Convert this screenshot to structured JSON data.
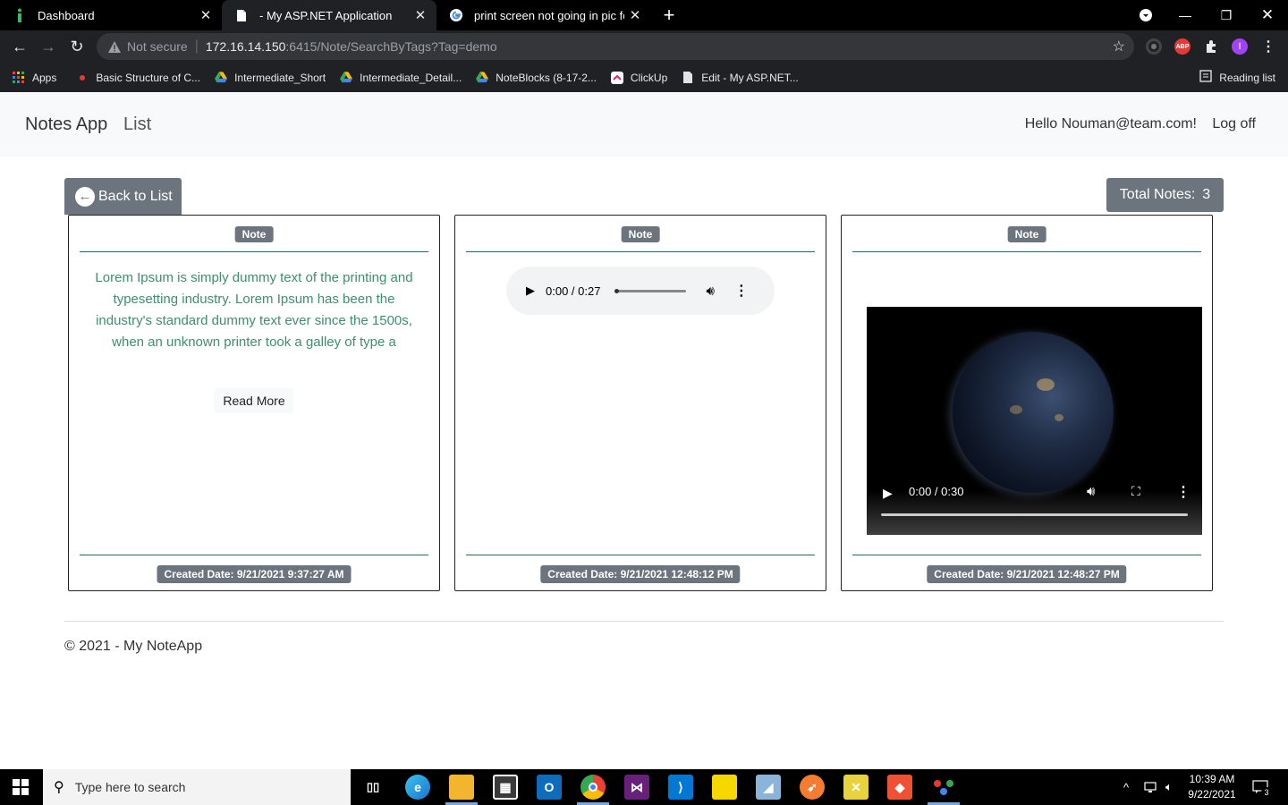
{
  "browser": {
    "tabs": [
      {
        "title": "Dashboard",
        "favicon": "info-icon"
      },
      {
        "title": "- My ASP.NET Application",
        "favicon": "page-icon"
      },
      {
        "title": "print screen not going in pic fold",
        "favicon": "google-icon"
      }
    ],
    "new_tab_label": "+",
    "security_label": "Not secure",
    "url_host": "172.16.14.150",
    "url_path": ":6415/Note/SearchByTags?Tag=demo",
    "extensions": [
      "github-icon",
      "adblock-icon",
      "puzzle-icon",
      "profile-icon"
    ],
    "abp_label": "ABP",
    "profile_initial": "I",
    "bookmarks": [
      {
        "label": "Apps",
        "icon": "apps-grid-icon"
      },
      {
        "label": "Basic Structure of C...",
        "icon": "red-dot-icon"
      },
      {
        "label": "Intermediate_Short",
        "icon": "drive-icon"
      },
      {
        "label": "Intermediate_Detail...",
        "icon": "drive-icon"
      },
      {
        "label": "NoteBlocks (8-17-2...",
        "icon": "drive-icon"
      },
      {
        "label": "ClickUp",
        "icon": "clickup-icon"
      },
      {
        "label": "Edit - My ASP.NET...",
        "icon": "page-icon"
      }
    ],
    "reading_list": "Reading list"
  },
  "app": {
    "brand": "Notes App",
    "nav_list": "List",
    "greeting": "Hello Nouman@team.com!",
    "logoff": "Log off",
    "back_label": "Back to List",
    "total_label": "Total Notes:",
    "total_count": "3",
    "notes": [
      {
        "badge": "Note",
        "type": "text",
        "text": "Lorem Ipsum is simply dummy text of the printing and typesetting industry. Lorem Ipsum has been the industry's standard dummy text ever since the 1500s, when an unknown printer took a galley of type a",
        "read_more": "Read More",
        "created": "Created Date:  9/21/2021 9:37:27 AM"
      },
      {
        "badge": "Note",
        "type": "audio",
        "time": "0:00 / 0:27",
        "created": "Created Date:  9/21/2021 12:48:12 PM"
      },
      {
        "badge": "Note",
        "type": "video",
        "time": "0:00 / 0:30",
        "created": "Created Date:  9/21/2021 12:48:27 PM"
      }
    ],
    "footer": "© 2021 - My NoteApp"
  },
  "taskbar": {
    "search_placeholder": "Type here to search",
    "time": "10:39 AM",
    "date": "9/22/2021",
    "notification_count": "3"
  }
}
